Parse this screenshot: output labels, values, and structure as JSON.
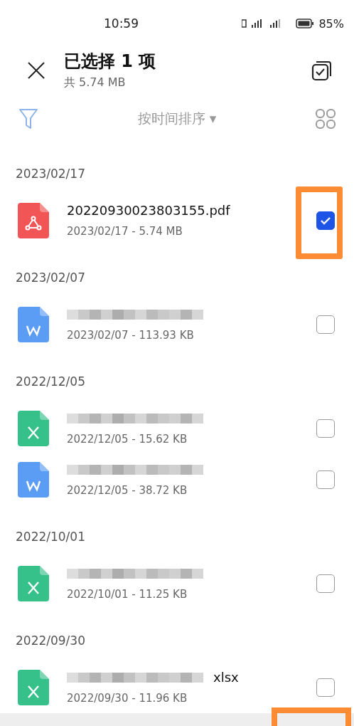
{
  "status_bar": {
    "time": "10:59",
    "battery": "85%"
  },
  "header": {
    "title": "已选择 1 项",
    "subtitle": "共 5.74 MB"
  },
  "toolbar": {
    "sort": "按时间排序 ▾"
  },
  "groups": [
    {
      "date": "2023/02/17",
      "files": [
        {
          "kind": "pdf",
          "name": "20220930023803155.pdf",
          "redacted": false,
          "meta": "2023/02/17 - 5.74 MB",
          "selected": true,
          "highlighted": true
        }
      ]
    },
    {
      "date": "2023/02/07",
      "files": [
        {
          "kind": "doc",
          "redacted": true,
          "meta": "2023/02/07 - 113.93 KB",
          "selected": false,
          "highlighted": false
        }
      ]
    },
    {
      "date": "2022/12/05",
      "files": [
        {
          "kind": "xls",
          "redacted": true,
          "meta": "2022/12/05 - 15.62 KB",
          "selected": false,
          "highlighted": false
        },
        {
          "kind": "doc",
          "redacted": true,
          "meta": "2022/12/05 - 38.72 KB",
          "selected": false,
          "highlighted": false
        }
      ]
    },
    {
      "date": "2022/10/01",
      "files": [
        {
          "kind": "xls",
          "redacted": true,
          "meta": "2022/10/01 - 11.25 KB",
          "selected": false,
          "highlighted": false
        }
      ]
    },
    {
      "date": "2022/09/30",
      "files": [
        {
          "kind": "xls",
          "redacted": true,
          "name_tail": "xlsx",
          "meta": "2022/09/30 - 11.96 KB",
          "selected": false,
          "highlighted": false
        }
      ]
    }
  ],
  "bottom_bar": {
    "highlighted": true
  }
}
